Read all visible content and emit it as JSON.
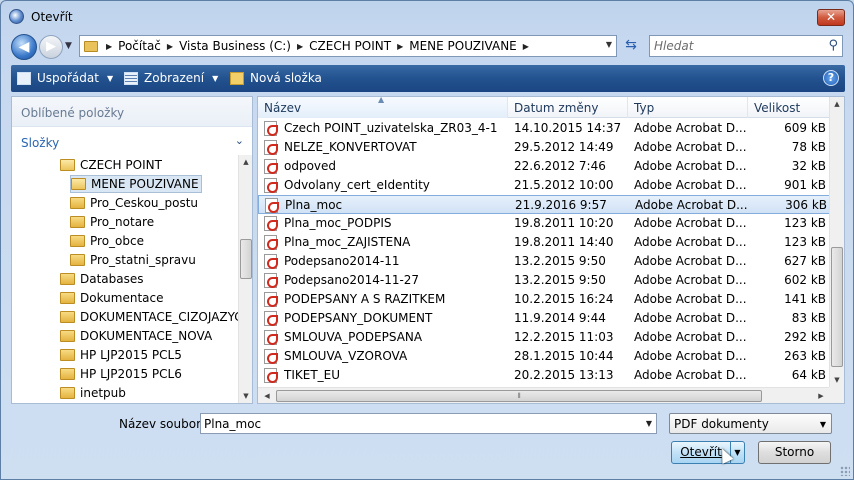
{
  "window": {
    "title": "Otevřít",
    "close_label": "✕"
  },
  "address": {
    "crumbs": [
      "Počítač",
      "Vista Business (C:)",
      "CZECH POINT",
      "MENE POUZIVANE"
    ],
    "search_placeholder": "Hledat"
  },
  "toolbar": {
    "organize_label": "Uspořádat",
    "views_label": "Zobrazení",
    "new_folder_label": "Nová složka",
    "help_label": "?"
  },
  "nav_pane": {
    "favorites_label": "Oblíbené položky",
    "folders_label": "Složky",
    "tree": [
      {
        "label": "CZECH POINT",
        "level": 1,
        "open": true
      },
      {
        "label": "MENE POUZIVANE",
        "level": 2,
        "open": true,
        "selected": true
      },
      {
        "label": "Pro_Ceskou_postu",
        "level": 2
      },
      {
        "label": "Pro_notare",
        "level": 2
      },
      {
        "label": "Pro_obce",
        "level": 2
      },
      {
        "label": "Pro_statni_spravu",
        "level": 2
      },
      {
        "label": "Databases",
        "level": 0
      },
      {
        "label": "Dokumentace",
        "level": 0
      },
      {
        "label": "DOKUMENTACE_CIZOJAZYCI",
        "level": 0
      },
      {
        "label": "DOKUMENTACE_NOVA",
        "level": 0
      },
      {
        "label": "HP LJP2015 PCL5",
        "level": 0
      },
      {
        "label": "HP LJP2015 PCL6",
        "level": 0
      },
      {
        "label": "inetpub",
        "level": 0
      }
    ]
  },
  "file_list": {
    "columns": [
      "Název",
      "Datum změny",
      "Typ",
      "Velikost"
    ],
    "rows": [
      {
        "name": "Czech POINT_uzivatelska_ZR03_4-1",
        "date": "14.10.2015 14:37",
        "type": "Adobe Acrobat D...",
        "size": "609 kB"
      },
      {
        "name": "NELZE_KONVERTOVAT",
        "date": "29.5.2012 14:49",
        "type": "Adobe Acrobat D...",
        "size": "78 kB"
      },
      {
        "name": "odpoved",
        "date": "22.6.2012 7:46",
        "type": "Adobe Acrobat D...",
        "size": "32 kB"
      },
      {
        "name": "Odvolany_cert_eIdentity",
        "date": "21.5.2012 10:00",
        "type": "Adobe Acrobat D...",
        "size": "901 kB"
      },
      {
        "name": "Plna_moc",
        "date": "21.9.2016 9:57",
        "type": "Adobe Acrobat D...",
        "size": "306 kB",
        "selected": true
      },
      {
        "name": "Plna_moc_PODPIS",
        "date": "19.8.2011 10:20",
        "type": "Adobe Acrobat D...",
        "size": "123 kB"
      },
      {
        "name": "Plna_moc_ZAJISTENA",
        "date": "19.8.2011 14:40",
        "type": "Adobe Acrobat D...",
        "size": "123 kB"
      },
      {
        "name": "Podepsano2014-11",
        "date": "13.2.2015 9:50",
        "type": "Adobe Acrobat D...",
        "size": "627 kB"
      },
      {
        "name": "Podepsano2014-11-27",
        "date": "13.2.2015 9:50",
        "type": "Adobe Acrobat D...",
        "size": "602 kB"
      },
      {
        "name": "PODEPSANY A S RAZITKEM",
        "date": "10.2.2015 16:24",
        "type": "Adobe Acrobat D...",
        "size": "141 kB"
      },
      {
        "name": "PODEPSANY_DOKUMENT",
        "date": "11.9.2014 9:44",
        "type": "Adobe Acrobat D...",
        "size": "83 kB"
      },
      {
        "name": "SMLOUVA_PODEPSANA",
        "date": "12.2.2015 11:03",
        "type": "Adobe Acrobat D...",
        "size": "292 kB"
      },
      {
        "name": "SMLOUVA_VZOROVA",
        "date": "28.1.2015 10:44",
        "type": "Adobe Acrobat D...",
        "size": "263 kB"
      },
      {
        "name": "TIKET_EU",
        "date": "20.2.2015 13:13",
        "type": "Adobe Acrobat D...",
        "size": "64 kB"
      }
    ]
  },
  "footer": {
    "filename_label": "Název souboru:",
    "filename_value": "Plna_moc",
    "filetype_value": "PDF dokumenty",
    "open_label": "Otevřít",
    "cancel_label": "Storno"
  }
}
